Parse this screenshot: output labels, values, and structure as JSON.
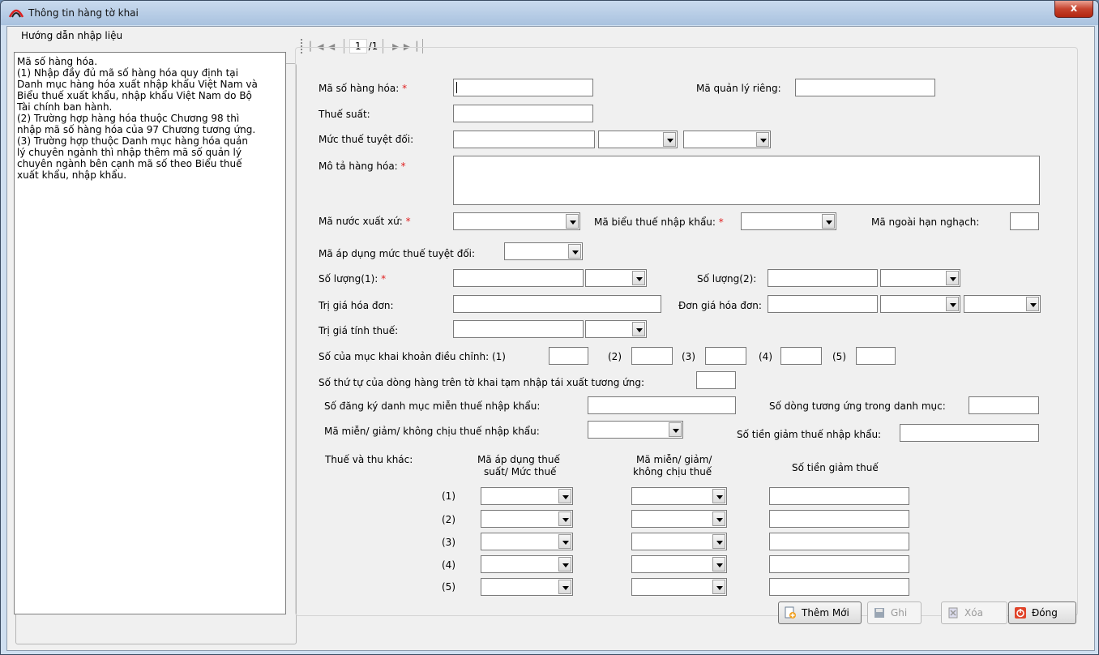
{
  "window": {
    "title": "Thông tin hàng tờ khai",
    "close_label": "x"
  },
  "pager": {
    "page": "1",
    "total": "/1"
  },
  "guide": {
    "legend": "Hướng dẫn nhập liệu",
    "lines": [
      "Mã số hàng hóa.",
      "(1) Nhập đầy đủ mã số hàng hóa quy định tại",
      "Danh mục hàng hóa xuất nhập khẩu Việt Nam và",
      "Biểu thuế xuất khẩu, nhập khẩu Việt Nam do Bộ",
      "Tài chính ban hành.",
      "(2) Trường hợp hàng hóa thuộc Chương 98 thì",
      "nhập mã số hàng hóa của 97 Chương tương ứng.",
      "(3) Trường hợp thuộc Danh mục hàng hóa quản",
      "lý chuyên ngành thì nhập thêm mã số quản lý",
      "chuyên ngành bên cạnh mã số theo Biểu thuế",
      "xuất khẩu, nhập khẩu."
    ]
  },
  "form": {
    "ma_so_hang_hoa": "Mã số hàng hóa:",
    "ma_quan_ly_rieng": "Mã quản lý riêng:",
    "thue_suat": "Thuế suất:",
    "muc_thue_tuyet_doi": "Mức thuế tuyệt đối:",
    "mo_ta_hang_hoa": "Mô tả hàng hóa:",
    "ma_nuoc_xuat_xu": "Mã nước xuất xứ:",
    "ma_bieu_thue_nk": "Mã biểu thuế nhập khẩu:",
    "ma_ngoai_han_ngach": "Mã ngoài hạn nghạch:",
    "ma_ap_dung_mttd": "Mã áp dụng mức thuế tuyệt đối:",
    "so_luong_1": "Số lượng(1):",
    "so_luong_2": "Số lượng(2):",
    "tri_gia_hoa_don": "Trị giá hóa đơn:",
    "don_gia_hoa_don": "Đơn giá hóa đơn:",
    "tri_gia_tinh_thue": "Trị giá tính thuế:",
    "so_muc_khai_dc": "Số của mục khai khoản điều chỉnh: (1)",
    "n2": "(2)",
    "n3": "(3)",
    "n4": "(4)",
    "n5": "(5)",
    "so_thu_tu_dong_hang": "Số thứ tự của dòng hàng trên tờ khai tạm nhập tái xuất tương ứng:",
    "so_dang_ky_dm": "Số đăng ký danh mục miễn thuế nhập khẩu:",
    "so_dong_tuong_ung": "Số dòng tương ứng trong danh mục:",
    "ma_mien_giam": "Mã miễn/ giảm/ không chịu thuế nhập khẩu:",
    "so_tien_giam": "Số tiền giảm thuế nhập khẩu:",
    "thue_thu_khac": "Thuế và thu khác:",
    "col1_l1": "Mã áp dụng thuế",
    "col1_l2": "suất/ Mức thuế",
    "col2_l1": "Mã miễn/ giảm/",
    "col2_l2": "không chịu thuế",
    "col3": "Số tiền giảm thuế",
    "r1": "(1)",
    "r2": "(2)",
    "r3": "(3)",
    "r4": "(4)",
    "r5": "(5)",
    "required_mark": "*"
  },
  "buttons": {
    "add": "Thêm Mới",
    "save": "Ghi",
    "delete": "Xóa",
    "close": "Đóng"
  },
  "colors": {
    "titlebar": "#a9c2df",
    "close": "#c6432e",
    "required": "#e02020"
  }
}
